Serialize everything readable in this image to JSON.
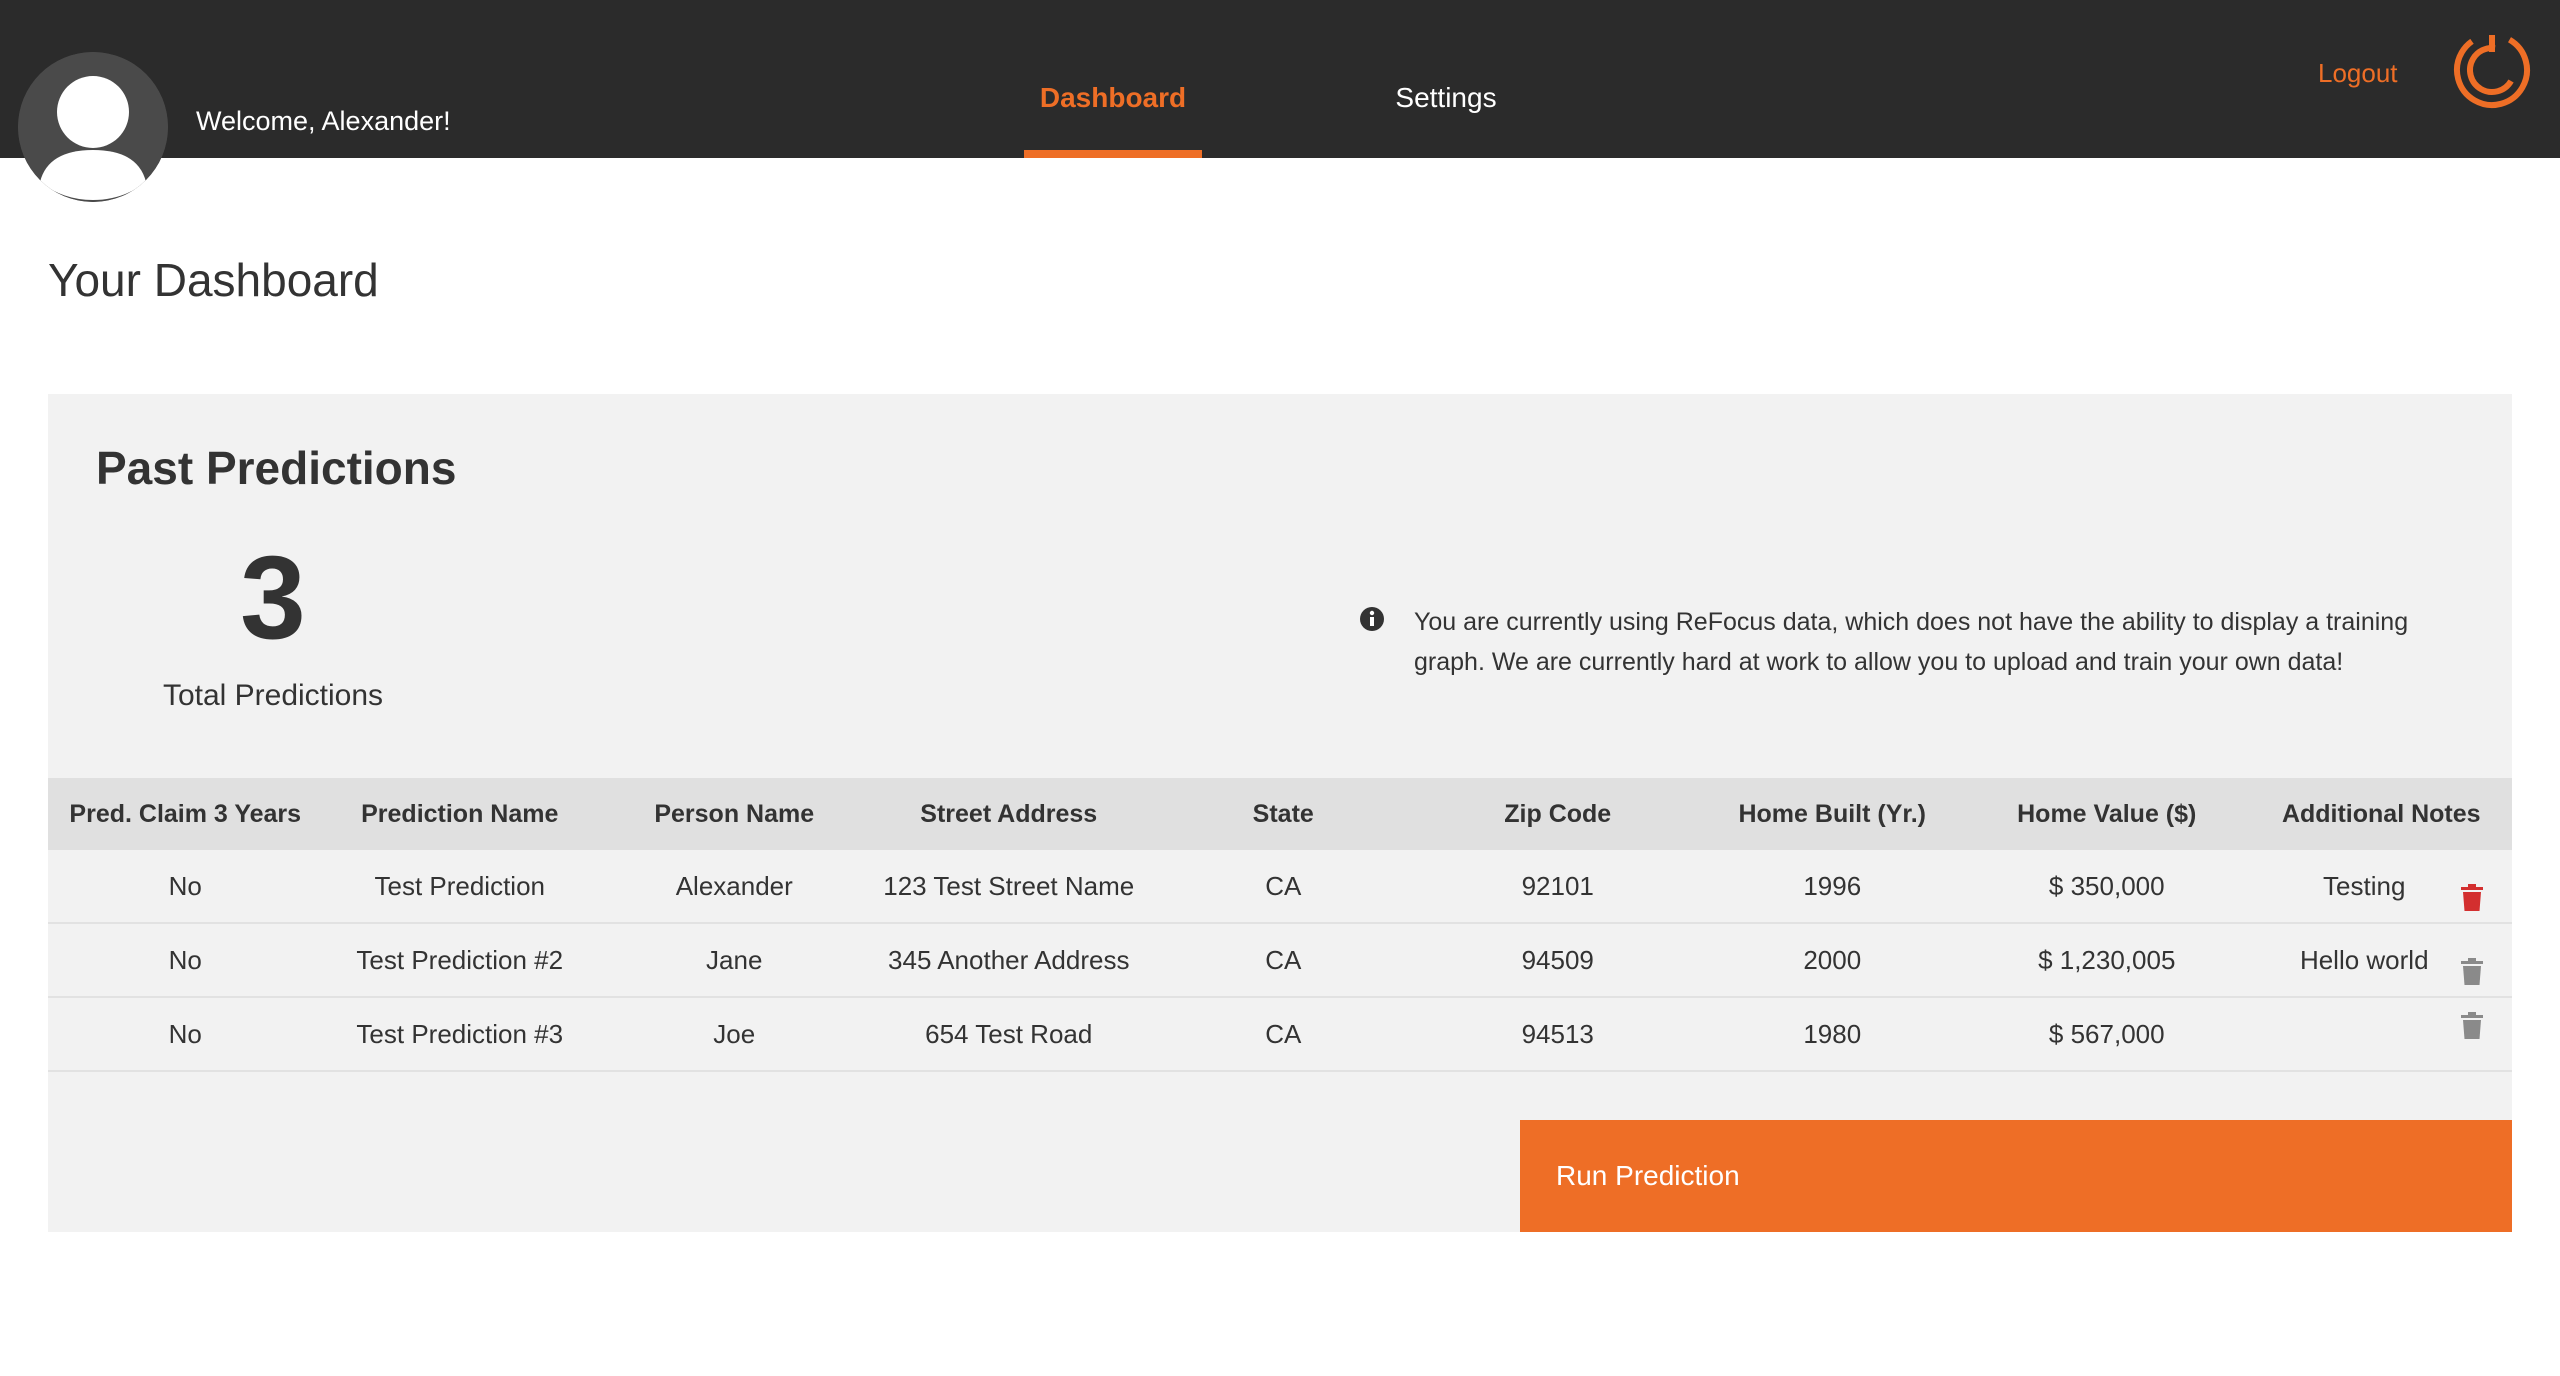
{
  "header": {
    "welcome": "Welcome, Alexander!",
    "tabs": [
      {
        "label": "Dashboard",
        "active": true
      },
      {
        "label": "Settings",
        "active": false
      }
    ],
    "logout": "Logout",
    "accent_color": "#ee6e26",
    "background_color": "#2b2b2b"
  },
  "page": {
    "title": "Your Dashboard"
  },
  "panel": {
    "title": "Past Predictions",
    "total_count": "3",
    "total_label": "Total Predictions",
    "info_icon": "info-circle-icon",
    "info_text": "You are currently using ReFocus data, which does not have the ability to display a training graph. We are currently hard at work to allow you to upload and train your own data!",
    "background_color": "#f2f2f2"
  },
  "table": {
    "columns": [
      "Pred. Claim 3 Years",
      "Prediction Name",
      "Person Name",
      "Street Address",
      "State",
      "Zip Code",
      "Home Built (Yr.)",
      "Home Value ($)",
      "Additional Notes"
    ],
    "rows": [
      {
        "cells": [
          "No",
          "Test Prediction",
          "Alexander",
          "123 Test Street Name",
          "CA",
          "92101",
          "1996",
          "$ 350,000",
          "Testing"
        ],
        "delete_icon": "trash-icon",
        "delete_color": "#d32f2f"
      },
      {
        "cells": [
          "No",
          "Test Prediction #2",
          "Jane",
          "345 Another Address",
          "CA",
          "94509",
          "2000",
          "$ 1,230,005",
          "Hello world"
        ],
        "delete_icon": "trash-icon",
        "delete_color": "#8a8a8a"
      },
      {
        "cells": [
          "No",
          "Test Prediction #3",
          "Joe",
          "654 Test Road",
          "CA",
          "94513",
          "1980",
          "$ 567,000",
          ""
        ],
        "delete_icon": "trash-icon",
        "delete_color": "#8a8a8a"
      }
    ]
  },
  "actions": {
    "run_prediction": "Run Prediction"
  }
}
